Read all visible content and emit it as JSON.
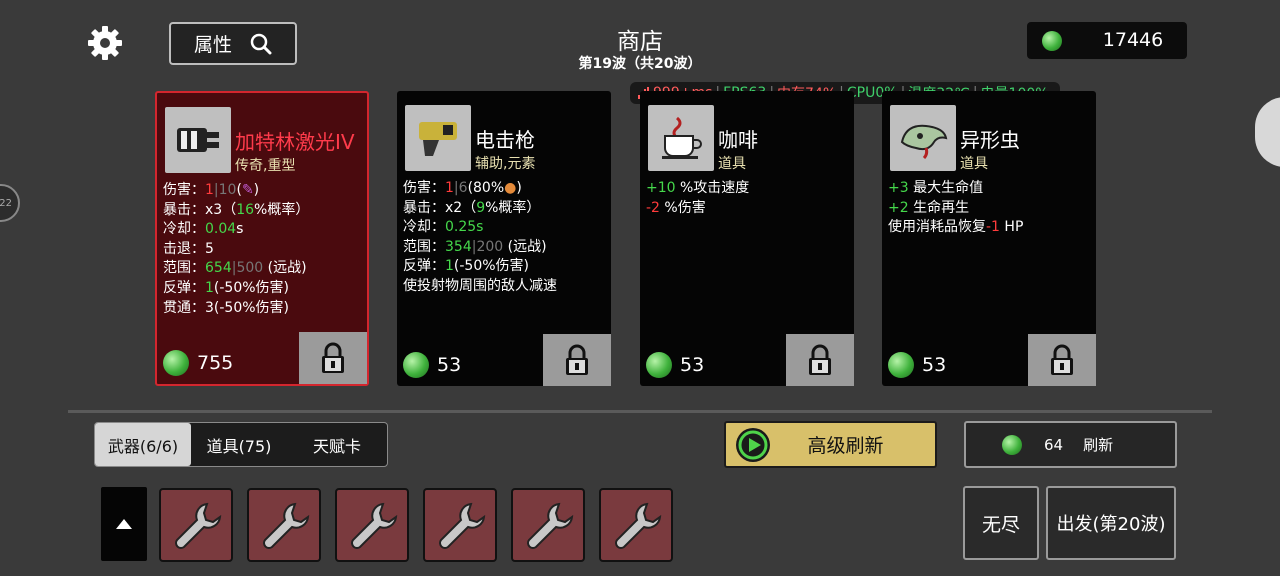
{
  "header": {
    "attr_label": "属性",
    "shop_title": "商店",
    "wave_text": "第19波（共20波）",
    "money": "17446"
  },
  "perf": {
    "ping": "999+ms",
    "fps": "FPS63",
    "mem": "内存74%",
    "cpu": "CPU0%",
    "temp": "温度32℃",
    "battery": "电量100%"
  },
  "cards": [
    {
      "name": "加特林激光IV",
      "tags": "传奇,重型",
      "price": "755",
      "icon": "gatling-laser-icon",
      "stats": {
        "dmg_label": "伤害：",
        "dmg_a": "1",
        "dmg_sep": "|",
        "dmg_b": "10",
        "dmg_c": "(",
        "dmg_d": ")",
        "crit_label": "暴击：",
        "crit_a": "x3（",
        "crit_b": "16",
        "crit_c": "%概率）",
        "cd_label": "冷却：",
        "cd_val": "0.04",
        "cd_unit": "s",
        "kb_label": "击退：",
        "kb_val": "5",
        "range_label": "范围：",
        "range_a": "654",
        "range_sep": "|",
        "range_b": "500",
        "range_c": " (远战)",
        "bounce_label": "反弹：",
        "bounce_a": "1",
        "bounce_b": "(-50%伤害)",
        "pierce_label": "贯通：",
        "pierce_val": "3(-50%伤害)"
      }
    },
    {
      "name": "电击枪",
      "tags": "辅助,元素",
      "price": "53",
      "icon": "taser-icon",
      "stats": {
        "dmg_label": "伤害：",
        "dmg_a": "1",
        "dmg_sep": "|",
        "dmg_b": "6",
        "dmg_c": "(80%",
        "dmg_d": ")",
        "crit_label": "暴击：",
        "crit_a": "x2（",
        "crit_b": "9",
        "crit_c": "%概率）",
        "cd_label": "冷却：",
        "cd_val": "0.25",
        "cd_unit": "s",
        "range_label": "范围：",
        "range_a": "354",
        "range_sep": "|",
        "range_b": "200",
        "range_c": " (远战)",
        "bounce_label": "反弹：",
        "bounce_a": "1",
        "bounce_b": "(-50%伤害)",
        "extra": "使投射物周围的敌人减速"
      }
    },
    {
      "name": "咖啡",
      "tags": "道具",
      "price": "53",
      "icon": "coffee-icon",
      "lines": [
        {
          "a": "+10",
          "b": " %攻击速度",
          "color": "green"
        },
        {
          "a": "-2",
          "b": " %伤害",
          "color": "red"
        }
      ]
    },
    {
      "name": "异形虫",
      "tags": "道具",
      "price": "53",
      "icon": "alien-worm-icon",
      "lines": [
        {
          "a": "+3",
          "b": " 最大生命值",
          "color": "green"
        },
        {
          "a": "+2",
          "b": " 生命再生",
          "color": "green"
        }
      ],
      "extra_pre": "使用消耗品恢复",
      "extra_num": "-1",
      "extra_post": " HP"
    }
  ],
  "tabs": [
    "武器(6/6)",
    "道具(75)",
    "天赋卡"
  ],
  "buttons": {
    "adv_refresh": "高级刷新",
    "refresh_cost": "64",
    "refresh": "刷新",
    "endless": "无尽",
    "depart": "出发(第20波)"
  },
  "edge_left_text": "22"
}
